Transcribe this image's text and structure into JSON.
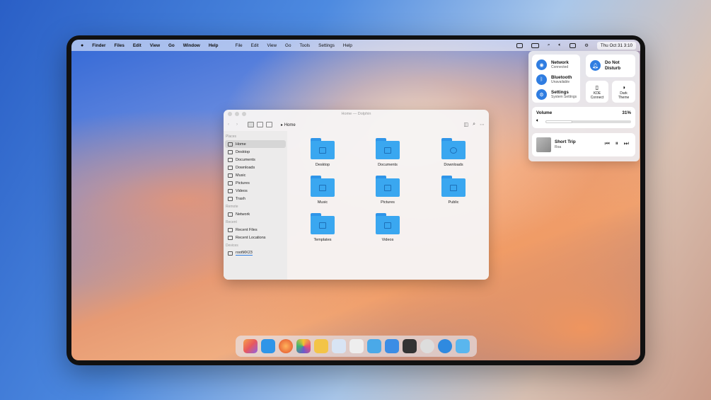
{
  "menubar": {
    "apple": "",
    "left_items": [
      "Finder",
      "Files",
      "Edit",
      "View",
      "Go",
      "Window",
      "Help"
    ],
    "mid_items": [
      "File",
      "Edit",
      "View",
      "Go",
      "Tools",
      "Settings",
      "Help"
    ],
    "clock": "Thu Oct 31 3:10"
  },
  "quick_settings": {
    "network": {
      "title": "Network",
      "sub": "Connected"
    },
    "bluetooth": {
      "title": "Bluetooth",
      "sub": "Unavailable"
    },
    "settings": {
      "title": "Settings",
      "sub": "System Settings"
    },
    "dnd": {
      "title": "Do Not\nDisturb"
    },
    "kde": {
      "title": "KDE Connect"
    },
    "dark": {
      "title": "Dark Theme"
    },
    "volume": {
      "title": "Volume",
      "value": "31%",
      "level": 0.31
    },
    "media": {
      "track": "Short Trip",
      "artist": "Roa"
    }
  },
  "window": {
    "title": "Home — Dolphin",
    "breadcrumb": "Home",
    "sidebar": {
      "places_header": "Places",
      "places": [
        "Home",
        "Desktop",
        "Documents",
        "Downloads",
        "Music",
        "Pictures",
        "Videos",
        "Trash"
      ],
      "remote_header": "Remote",
      "remote": [
        "Network"
      ],
      "recent_header": "Recent",
      "recent": [
        "Recent Files",
        "Recent Locations"
      ],
      "devices_header": "Devices",
      "devices": [
        "rootMX23"
      ]
    },
    "folders": [
      "Desktop",
      "Documents",
      "Downloads",
      "Music",
      "Pictures",
      "Public",
      "Templates",
      "Videos"
    ]
  },
  "colors": {
    "accent": "#2f7de1",
    "folder": "#3aa7f0"
  }
}
